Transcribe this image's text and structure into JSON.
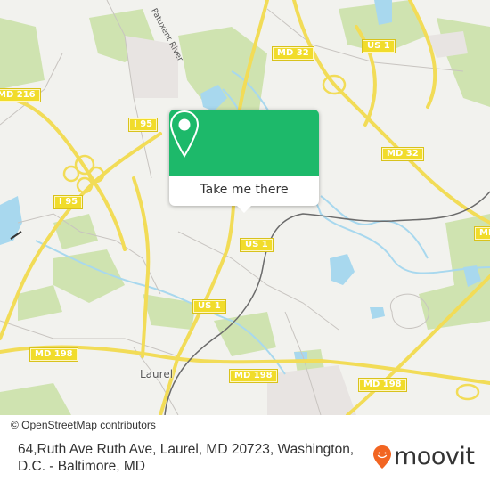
{
  "map": {
    "shields": [
      {
        "label": "MD 32"
      },
      {
        "label": "US 1"
      },
      {
        "label": "MD 216"
      },
      {
        "label": "I 95"
      },
      {
        "label": "I 95"
      },
      {
        "label": "MD 32"
      },
      {
        "label": "US 1"
      },
      {
        "label": "US 1"
      },
      {
        "label": "MD 198"
      },
      {
        "label": "MD 198"
      },
      {
        "label": "MD 198"
      },
      {
        "label": "MD"
      }
    ],
    "place_labels": {
      "laurel": "Laurel",
      "river": "Patuxent River"
    },
    "colors": {
      "background": "#f2f2ee",
      "water": "#a8d8ee",
      "park": "#cfe3b0",
      "highway": "#f2dc57",
      "rail": "#6b6b6b",
      "popup_green": "#1db96a",
      "moovit_orange": "#f26522"
    }
  },
  "popup": {
    "icon": "map-pin-icon",
    "button_label": "Take me there"
  },
  "attribution": {
    "text": "© OpenStreetMap contributors"
  },
  "footer": {
    "address": "64,Ruth Ave Ruth Ave, Laurel, MD 20723, Washington, D.C. - Baltimore, MD",
    "brand_name": "moovit",
    "brand_icon": "moovit-logo-icon"
  }
}
